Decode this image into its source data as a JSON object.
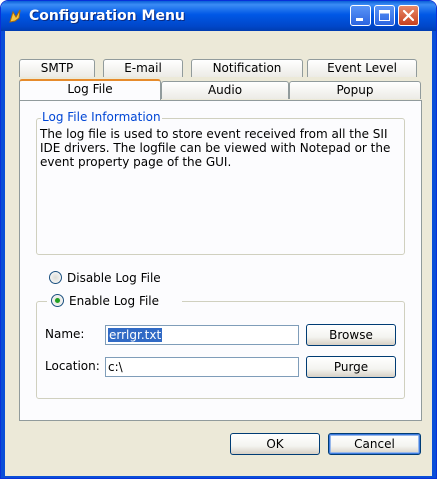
{
  "window": {
    "title": "Configuration Menu"
  },
  "titlebar_buttons": {
    "minimize_icon": "minimize-icon",
    "maximize_icon": "maximize-icon",
    "close_icon": "close-icon"
  },
  "tabs": {
    "row1": [
      {
        "label": "SMTP"
      },
      {
        "label": "E-mail"
      },
      {
        "label": "Notification"
      },
      {
        "label": "Event Level"
      }
    ],
    "row2": [
      {
        "label": "Log File",
        "active": true
      },
      {
        "label": "Audio"
      },
      {
        "label": "Popup"
      }
    ]
  },
  "log_info": {
    "legend": "Log File Information",
    "text": "The log file is used to store event received from all the SII IDE drivers. The logfile can be viewed with Notepad or the event property page of the GUI."
  },
  "options": {
    "disable_label": "Disable Log File",
    "enable_label": "Enable  Log File",
    "selected": "enable"
  },
  "fields": {
    "name_label": "Name:",
    "name_value": "errlgr.txt",
    "location_label": "Location:",
    "location_value": "c:\\"
  },
  "buttons": {
    "browse": "Browse",
    "purge": "Purge",
    "ok": "OK",
    "cancel": "Cancel"
  },
  "colors": {
    "titlebar": "#0058e6",
    "dialog_bg": "#ece9d8",
    "legend_text": "#0046d5",
    "selection": "#316ac5",
    "close_button": "#c8401e"
  }
}
